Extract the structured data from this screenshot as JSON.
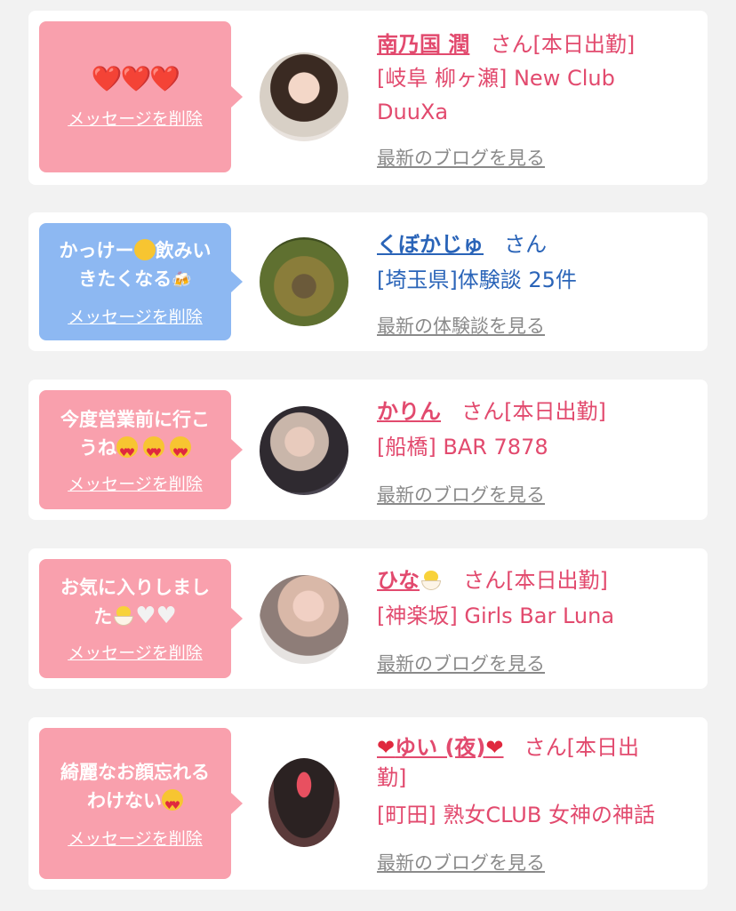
{
  "cards": [
    {
      "bubble_msg": "❤️❤️❤️",
      "delete_label": "メッセージを削除",
      "name": "南乃国 潤",
      "san": "さん[本日出勤]",
      "line1": "[岐阜 柳ヶ瀬] New Club",
      "line2": "DuuXa",
      "blog_link": "最新のブログを見る"
    },
    {
      "bubble_msg_1": "かっけー",
      "bubble_msg_2": "飲みい",
      "bubble_msg_3": "きたくなる",
      "delete_label": "メッセージを削除",
      "name": "くぼかじゅ",
      "san": "さん",
      "line1": "[埼玉県]体験談 25件",
      "blog_link": "最新の体験談を見る"
    },
    {
      "bubble_msg_1": "今度営業前に行こ",
      "bubble_msg_2": "うね",
      "delete_label": "メッセージを削除",
      "name": "かりん",
      "san": "さん[本日出勤]",
      "line1": "[船橋] BAR 7878",
      "blog_link": "最新のブログを見る"
    },
    {
      "bubble_msg_1": "お気に入りしまし",
      "bubble_msg_2": "た",
      "delete_label": "メッセージを削除",
      "name": "ひな",
      "san": "さん[本日出勤]",
      "line1": "[神楽坂] Girls Bar Luna",
      "blog_link": "最新のブログを見る"
    },
    {
      "bubble_msg_1": "綺麗なお顔忘れる",
      "bubble_msg_2": "わけない",
      "delete_label": "メッセージを削除",
      "name": "ゆい (夜)",
      "san": "さん[本日出",
      "san2": "勤]",
      "line1": "[町田] 熟女CLUB 女神の神話",
      "blog_link": "最新のブログを見る"
    }
  ],
  "colors": {
    "pink_bubble": "#f9a0ad",
    "blue_bubble": "#8db8f2",
    "pink_text": "#e24a6e",
    "blue_text": "#2a64b8"
  }
}
